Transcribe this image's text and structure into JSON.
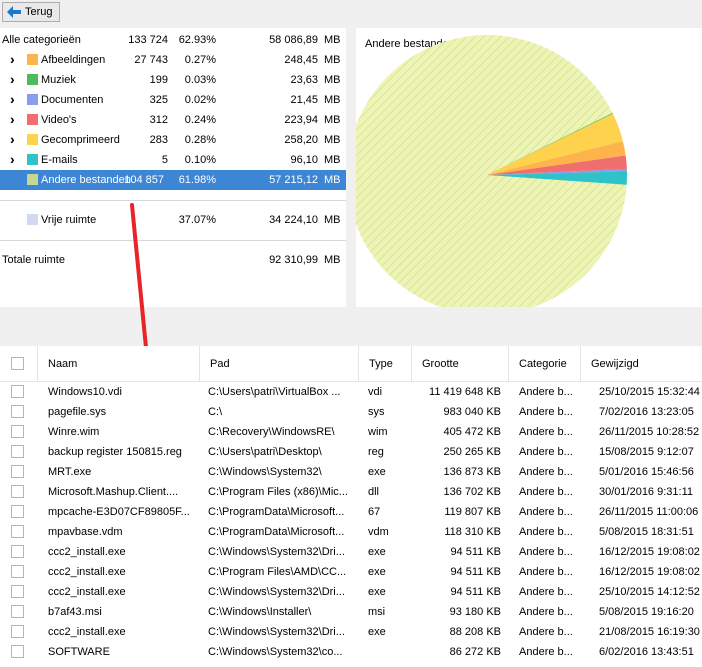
{
  "toolbar": {
    "back_label": "Terug"
  },
  "categories": {
    "all": {
      "label": "Alle categorieën",
      "count": "133 724",
      "pct": "62.93%",
      "size": "58 086,89",
      "unit": "MB"
    },
    "items": [
      {
        "label": "Afbeeldingen",
        "count": "27 743",
        "pct": "0.27%",
        "size": "248,45",
        "unit": "MB",
        "color": "#ffb34d"
      },
      {
        "label": "Muziek",
        "count": "199",
        "pct": "0.03%",
        "size": "23,63",
        "unit": "MB",
        "color": "#4cbb5c"
      },
      {
        "label": "Documenten",
        "count": "325",
        "pct": "0.02%",
        "size": "21,45",
        "unit": "MB",
        "color": "#8a9cf2"
      },
      {
        "label": "Video's",
        "count": "312",
        "pct": "0.24%",
        "size": "223,94",
        "unit": "MB",
        "color": "#f06e6e"
      },
      {
        "label": "Gecomprimeerd",
        "count": "283",
        "pct": "0.28%",
        "size": "258,20",
        "unit": "MB",
        "color": "#ffd24d"
      },
      {
        "label": "E-mails",
        "count": "5",
        "pct": "0.10%",
        "size": "96,10",
        "unit": "MB",
        "color": "#2fc2c8"
      },
      {
        "label": "Andere bestanden",
        "count": "104 857",
        "pct": "61.98%",
        "size": "57 215,12",
        "unit": "MB",
        "color": "#c4d895"
      }
    ],
    "free": {
      "label": "Vrije ruimte",
      "pct": "37.07%",
      "size": "34 224,10",
      "unit": "MB",
      "color": "#d3d8f5"
    },
    "total": {
      "label": "Totale ruimte",
      "size": "92 310,99",
      "unit": "MB"
    }
  },
  "pie": {
    "title": "Andere bestanden",
    "slices": [
      {
        "name": "Andere bestanden",
        "value": 61.98,
        "color": "#e7f0a8"
      },
      {
        "name": "Afbeeldingen",
        "value": 0.27,
        "color": "#ffb34d"
      },
      {
        "name": "Muziek",
        "value": 0.03,
        "color": "#4cbb5c"
      },
      {
        "name": "Documenten",
        "value": 0.02,
        "color": "#8a9cf2"
      },
      {
        "name": "Video's",
        "value": 0.24,
        "color": "#f06e6e"
      },
      {
        "name": "Gecomprimeerd",
        "value": 0.28,
        "color": "#ffd24d"
      },
      {
        "name": "E-mails",
        "value": 0.1,
        "color": "#2fc2c8"
      }
    ]
  },
  "table": {
    "headers": {
      "name": "Naam",
      "path": "Pad",
      "type": "Type",
      "size": "Grootte",
      "category": "Categorie",
      "modified": "Gewijzigd"
    },
    "rows": [
      {
        "name": "Windows10.vdi",
        "path": "C:\\Users\\patri\\VirtualBox ...",
        "type": "vdi",
        "size": "11 419 648 KB",
        "category": "Andere b...",
        "modified": "25/10/2015 15:32:44"
      },
      {
        "name": "pagefile.sys",
        "path": "C:\\",
        "type": "sys",
        "size": "983 040 KB",
        "category": "Andere b...",
        "modified": "7/02/2016 13:23:05"
      },
      {
        "name": "Winre.wim",
        "path": "C:\\Recovery\\WindowsRE\\",
        "type": "wim",
        "size": "405 472 KB",
        "category": "Andere b...",
        "modified": "26/11/2015 10:28:52"
      },
      {
        "name": "backup register 150815.reg",
        "path": "C:\\Users\\patri\\Desktop\\",
        "type": "reg",
        "size": "250 265 KB",
        "category": "Andere b...",
        "modified": "15/08/2015 9:12:07"
      },
      {
        "name": "MRT.exe",
        "path": "C:\\Windows\\System32\\",
        "type": "exe",
        "size": "136 873 KB",
        "category": "Andere b...",
        "modified": "5/01/2016 15:46:56"
      },
      {
        "name": "Microsoft.Mashup.Client....",
        "path": "C:\\Program Files (x86)\\Mic...",
        "type": "dll",
        "size": "136 702 KB",
        "category": "Andere b...",
        "modified": "30/01/2016 9:31:11"
      },
      {
        "name": "mpcache-E3D07CF89805F...",
        "path": "C:\\ProgramData\\Microsoft...",
        "type": "67",
        "size": "119 807 KB",
        "category": "Andere b...",
        "modified": "26/11/2015 11:00:06"
      },
      {
        "name": "mpavbase.vdm",
        "path": "C:\\ProgramData\\Microsoft...",
        "type": "vdm",
        "size": "118 310 KB",
        "category": "Andere b...",
        "modified": "5/08/2015 18:31:51"
      },
      {
        "name": "ccc2_install.exe",
        "path": "C:\\Windows\\System32\\Dri...",
        "type": "exe",
        "size": "94 511 KB",
        "category": "Andere b...",
        "modified": "16/12/2015 19:08:02"
      },
      {
        "name": "ccc2_install.exe",
        "path": "C:\\Program Files\\AMD\\CC...",
        "type": "exe",
        "size": "94 511 KB",
        "category": "Andere b...",
        "modified": "16/12/2015 19:08:02"
      },
      {
        "name": "ccc2_install.exe",
        "path": "C:\\Windows\\System32\\Dri...",
        "type": "exe",
        "size": "94 511 KB",
        "category": "Andere b...",
        "modified": "25/10/2015 14:12:52"
      },
      {
        "name": "b7af43.msi",
        "path": "C:\\Windows\\Installer\\",
        "type": "msi",
        "size": "93 180 KB",
        "category": "Andere b...",
        "modified": "5/08/2015 19:16:20"
      },
      {
        "name": "ccc2_install.exe",
        "path": "C:\\Windows\\System32\\Dri...",
        "type": "exe",
        "size": "88 208 KB",
        "category": "Andere b...",
        "modified": "21/08/2015 16:19:30"
      },
      {
        "name": "SOFTWARE",
        "path": "C:\\Windows\\System32\\co...",
        "type": "",
        "size": "86 272 KB",
        "category": "Andere b...",
        "modified": "6/02/2016 13:43:51"
      }
    ]
  },
  "colors": {
    "selection": "#3d86d6",
    "arrow": "#e8232a",
    "back_icon": "#1b78d0"
  }
}
